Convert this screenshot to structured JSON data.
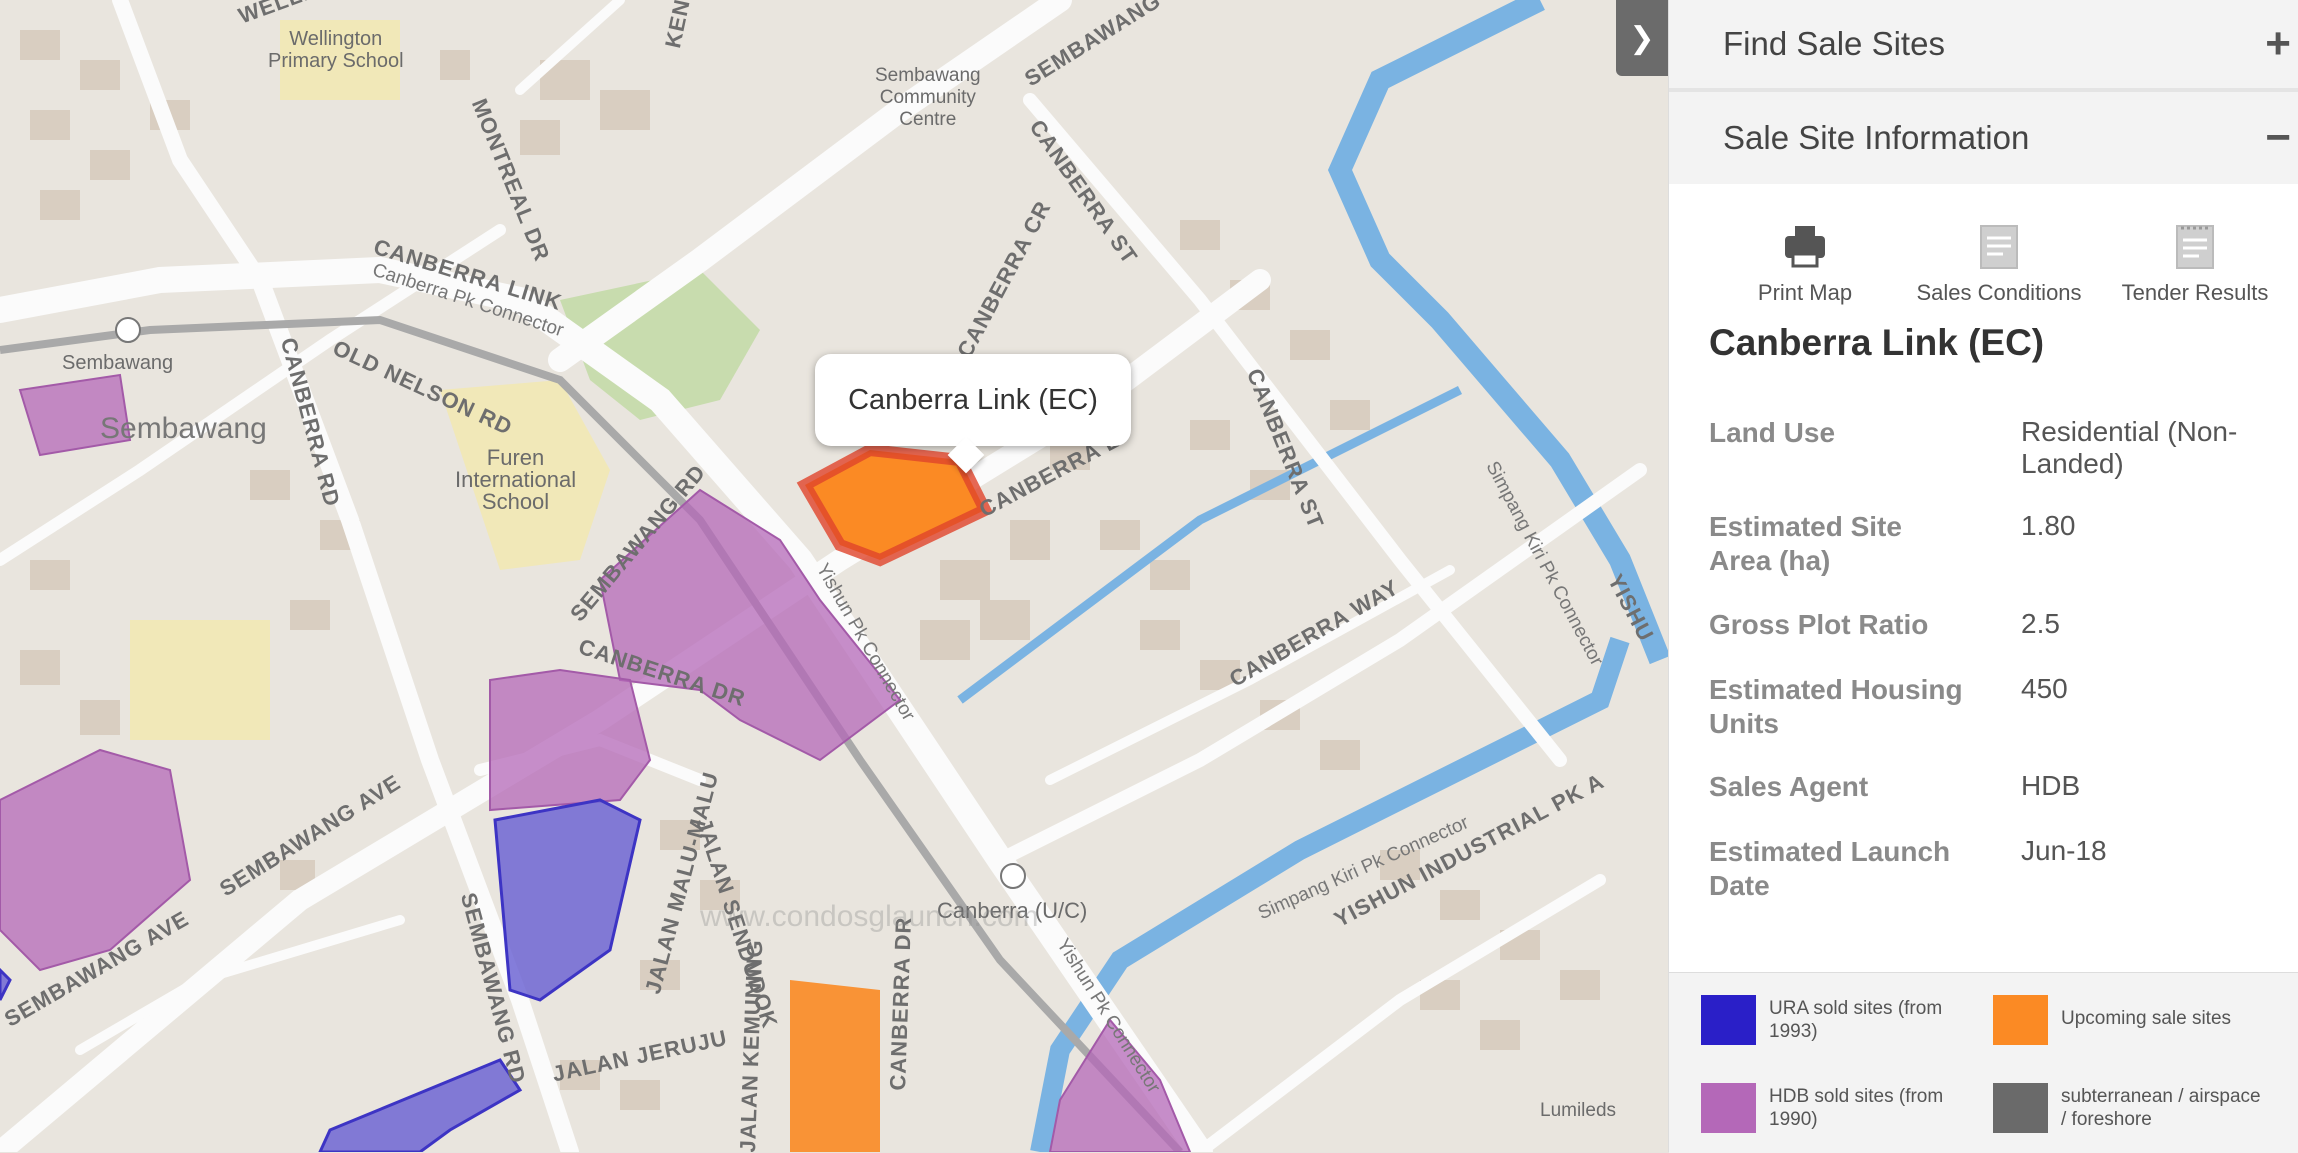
{
  "map": {
    "popup_label": "Canberra Link (EC)",
    "watermark": "www.condosglaunch.com",
    "toggle_icon": "chevron-right",
    "labels": {
      "wellington_school": "Wellington\nPrimary School",
      "sembawang_cc": "Sembawang\nCommunity\nCentre",
      "furen_school": "Furen\nInternational\nSchool",
      "sembawang_area": "Sembawang",
      "sembawang_mrt": "Sembawang",
      "canberra_uc": "Canberra (U/C)",
      "lumileds": "Lumileds",
      "canberra_link": "CANBERRA LINK",
      "canberra_pk_connector": "Canberra Pk Connector",
      "montreal_dr": "MONTREAL DR",
      "old_nelson_rd": "OLD NELSON RD",
      "canberra_rd": "CANBERRA RD",
      "sembawang_rd_1": "SEMBAWANG RD",
      "sembawang_rd_2": "SEMBAWANG RD",
      "canberra_dr_1": "CANBERRA DR",
      "canberra_dr_2": "CANBERRA DR",
      "sembawang_ave_1": "SEMBAWANG AVE",
      "sembawang_ave_2": "SEMBAWANG AVE",
      "canberra_st_1": "CANBERRA ST",
      "canberra_st_2": "CANBERRA ST",
      "canberra_cr": "CANBERRA CR",
      "canberra_way": "CANBERRA WAY",
      "canberra_link_2": "CANBERRA L",
      "yishun_pk_connector_1": "Yishun Pk Connector",
      "yishun_pk_connector_2": "Yishun Pk Connector",
      "simpang_kiri_1": "Simpang Kiri Pk Connector",
      "simpang_kiri_2": "Simpang Kiri Pk Connector",
      "yishun_industrial": "YISHUN INDUSTRIAL PK A",
      "jalan_malu_malu": "JALAN MALU-MALU",
      "jalan_sendudok": "JALAN SENDUDOK",
      "jalan_jeruju": "JALAN JERUJU",
      "jalan_kemuning": "JALAN KEMUNING",
      "sembawang_top": "SEMBAWANG",
      "yishun": "YISHU",
      "welli": "WELLI",
      "keny": "KENY"
    }
  },
  "panel": {
    "find_sale_sites": "Find Sale Sites",
    "find_sign": "+",
    "sale_site_info": "Sale Site Information",
    "info_sign": "−",
    "tools": {
      "print_map": "Print Map",
      "sales_conditions": "Sales Conditions",
      "tender_results": "Tender Results"
    },
    "site_name": "Canberra Link (EC)",
    "details": [
      {
        "key": "Land Use",
        "value": "Residential (Non-Landed)"
      },
      {
        "key": "Estimated Site Area (ha)",
        "value": "1.80"
      },
      {
        "key": "Gross Plot Ratio",
        "value": "2.5"
      },
      {
        "key": "Estimated Housing Units",
        "value": "450"
      },
      {
        "key": "Sales Agent",
        "value": "HDB"
      },
      {
        "key": "Estimated Launch Date",
        "value": "Jun-18"
      }
    ],
    "legend": [
      {
        "label": "URA sold sites (from 1993)",
        "color": "#2a1fc8"
      },
      {
        "label": "Upcoming sale sites",
        "color": "#fb8a24"
      },
      {
        "label": "HDB sold sites (from 1990)",
        "color": "#b468b8"
      },
      {
        "label": "subterranean / airspace / foreshore",
        "color": "#6a6a6a"
      }
    ]
  }
}
